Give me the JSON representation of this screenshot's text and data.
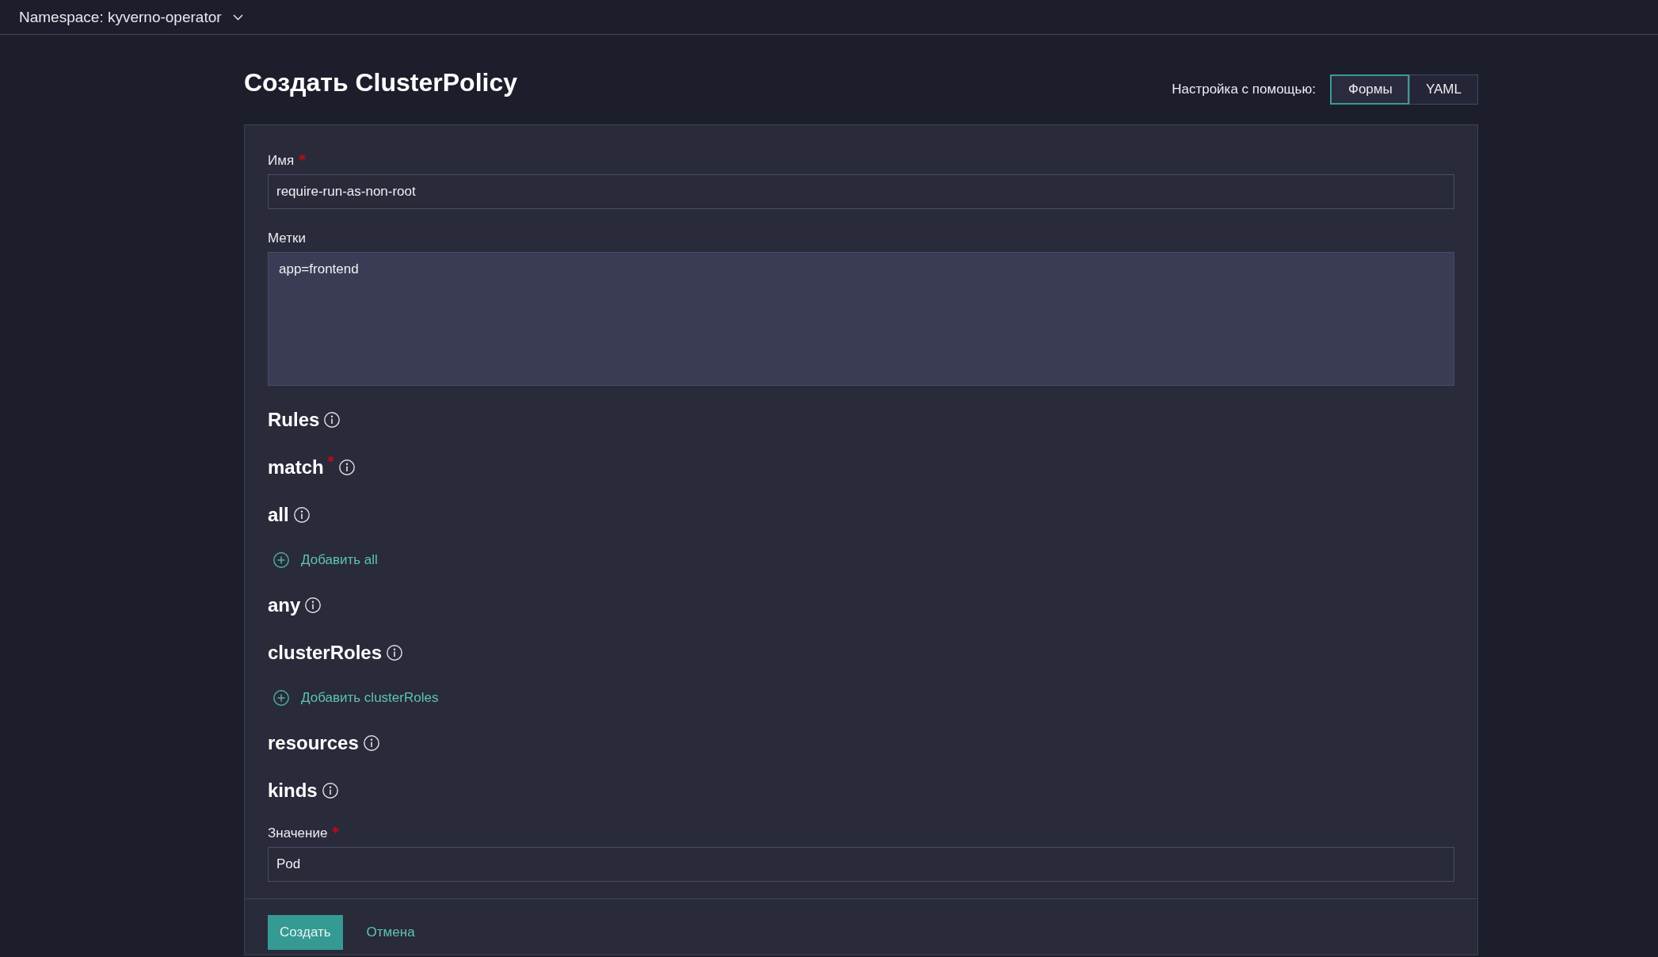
{
  "header": {
    "namespace_selector": {
      "label": "Namespace: kyverno-operator"
    }
  },
  "page": {
    "title": "Создать ClusterPolicy",
    "configure_with": {
      "label": "Настройка с помощью:",
      "options": [
        {
          "label": "Формы",
          "selected": true
        },
        {
          "label": "YAML",
          "selected": false
        }
      ]
    }
  },
  "form": {
    "items": [
      {
        "kind": "text_input",
        "label": "Имя",
        "required": true,
        "value": "require-run-as-non-root"
      },
      {
        "kind": "textarea",
        "label": "Метки",
        "required": false,
        "value": "app=frontend"
      },
      {
        "kind": "section",
        "title": "Rules",
        "required": false
      },
      {
        "kind": "section",
        "title": "match",
        "required": true
      },
      {
        "kind": "section",
        "title": "all",
        "required": false
      },
      {
        "kind": "add_link",
        "label": "Добавить all"
      },
      {
        "kind": "section",
        "title": "any",
        "required": false
      },
      {
        "kind": "section",
        "title": "clusterRoles",
        "required": false
      },
      {
        "kind": "add_link",
        "label": "Добавить clusterRoles"
      },
      {
        "kind": "section",
        "title": "resources",
        "required": false
      },
      {
        "kind": "section",
        "title": "kinds",
        "required": false
      },
      {
        "kind": "text_input",
        "label": "Значение",
        "required": true,
        "value": "Pod"
      }
    ]
  },
  "actions": [
    {
      "kind": "primary",
      "label": "Создать"
    },
    {
      "kind": "link",
      "label": "Отмена"
    }
  ]
}
